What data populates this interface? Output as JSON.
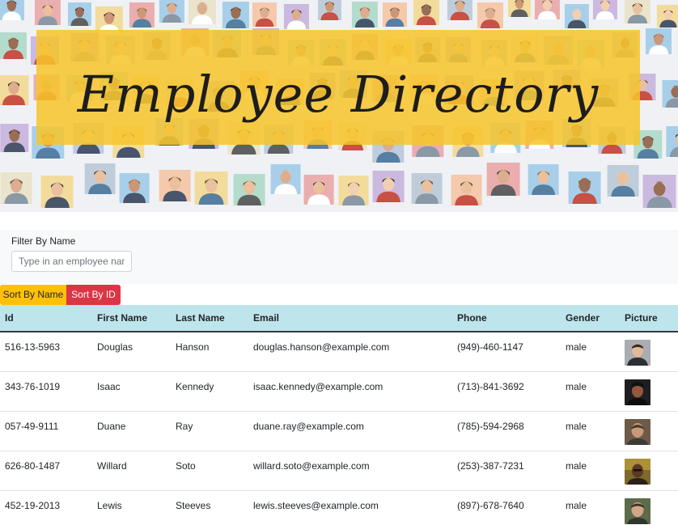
{
  "hero": {
    "title": "Employee Directory",
    "banner_color": "#f7c52b"
  },
  "filter": {
    "label": "Filter By Name",
    "placeholder": "Type in an employee name",
    "value": ""
  },
  "sort": {
    "by_name_label": "Sort By Name",
    "by_id_label": "Sort By ID",
    "by_name_color": "#ffc107",
    "by_id_color": "#dc3545"
  },
  "table": {
    "columns": [
      "Id",
      "First Name",
      "Last Name",
      "Email",
      "Phone",
      "Gender",
      "Picture"
    ],
    "rows": [
      {
        "id": "516-13-5963",
        "first": "Douglas",
        "last": "Hanson",
        "email": "douglas.hanson@example.com",
        "phone": "(949)-460-1147",
        "gender": "male",
        "picture": "person-photo-icon"
      },
      {
        "id": "343-76-1019",
        "first": "Isaac",
        "last": "Kennedy",
        "email": "isaac.kennedy@example.com",
        "phone": "(713)-841-3692",
        "gender": "male",
        "picture": "person-photo-icon"
      },
      {
        "id": "057-49-9111",
        "first": "Duane",
        "last": "Ray",
        "email": "duane.ray@example.com",
        "phone": "(785)-594-2968",
        "gender": "male",
        "picture": "person-photo-icon"
      },
      {
        "id": "626-80-1487",
        "first": "Willard",
        "last": "Soto",
        "email": "willard.soto@example.com",
        "phone": "(253)-387-7231",
        "gender": "male",
        "picture": "person-photo-icon"
      },
      {
        "id": "452-19-2013",
        "first": "Lewis",
        "last": "Steeves",
        "email": "lewis.steeves@example.com",
        "phone": "(897)-678-7640",
        "gender": "male",
        "picture": "person-photo-icon"
      }
    ]
  }
}
